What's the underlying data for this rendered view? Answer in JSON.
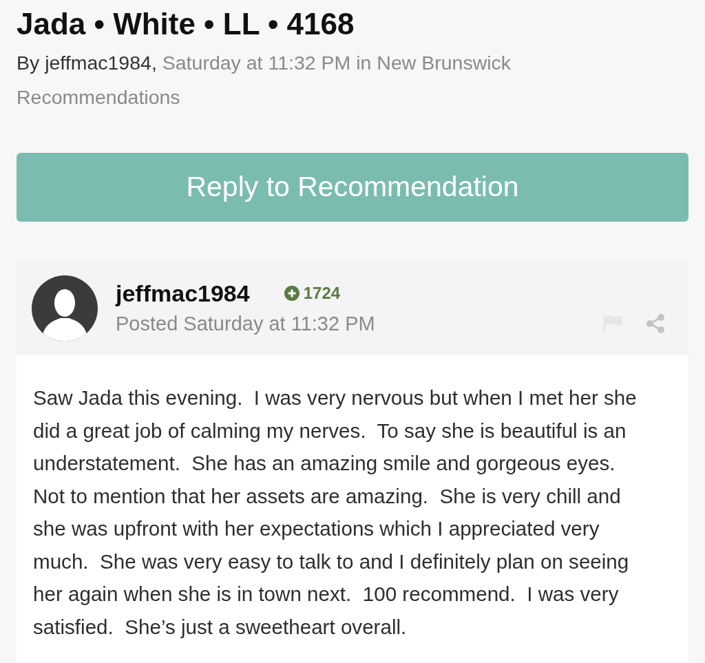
{
  "topic": {
    "title": "Jada • White • LL • 4168",
    "byline": {
      "author": "By jeffmac1984,",
      "details": "Saturday at 11:32 PM in New Brunswick Recommendations"
    }
  },
  "reply_button": {
    "label": "Reply to Recommendation"
  },
  "post": {
    "author": "jeffmac1984",
    "reputation": "1724",
    "posted": "Posted Saturday at 11:32 PM",
    "body": "Saw Jada this evening.  I was very nervous but when I met her she did a great job of calming my nerves.  To say she is beautiful is an understatement.  She has an amazing smile and gorgeous eyes.  Not to mention that her assets are amazing.  She is very chill and she was upfront with her expectations which I appreciated very much.  She was very easy to talk to and I definitely plan on seeing her again when she is in town next.  100 recommend.  I was very satisfied.  She’s just a sweetheart overall."
  }
}
